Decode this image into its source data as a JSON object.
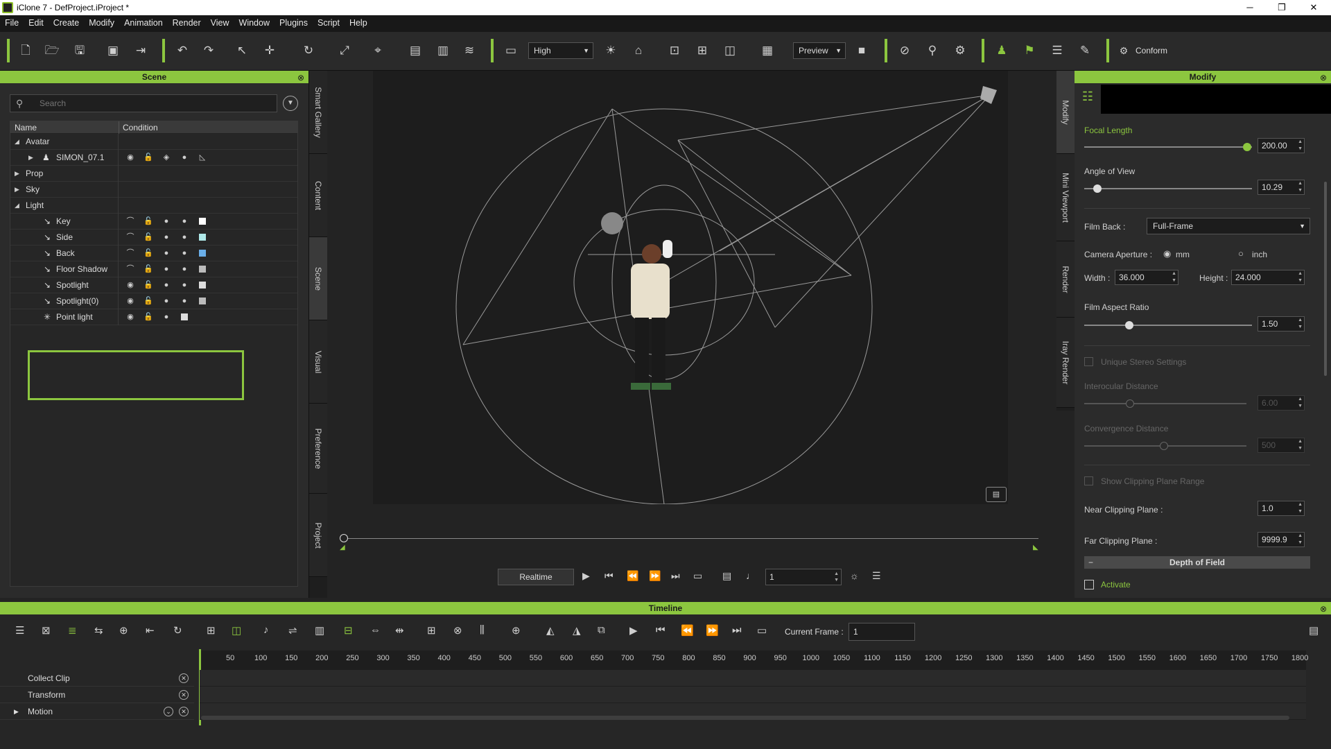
{
  "window": {
    "title": "iClone 7 - DefProject.iProject *",
    "controls": {
      "minimize": "─",
      "maximize": "❐",
      "close": "✕"
    }
  },
  "menu": [
    "File",
    "Edit",
    "Create",
    "Modify",
    "Animation",
    "Render",
    "View",
    "Window",
    "Plugins",
    "Script",
    "Help"
  ],
  "toolbar": {
    "quality": "High",
    "preview": "Preview",
    "conform": "Conform"
  },
  "scene_panel": {
    "title": "Scene",
    "search_placeholder": "Search",
    "columns": {
      "name": "Name",
      "condition": "Condition"
    },
    "rows": [
      {
        "label": "Avatar",
        "expanded": true
      },
      {
        "label": "SIMON_07.1"
      },
      {
        "label": "Prop"
      },
      {
        "label": "Sky"
      },
      {
        "label": "Light",
        "expanded": true
      },
      {
        "label": "Key",
        "swatch": "#ffffff"
      },
      {
        "label": "Side",
        "swatch": "#aee8e8"
      },
      {
        "label": "Back",
        "swatch": "#6aaee8"
      },
      {
        "label": "Floor Shadow",
        "swatch": "#bbbbbb"
      },
      {
        "label": "Spotlight",
        "swatch": "#dddddd"
      },
      {
        "label": "Spotlight(0)",
        "swatch": "#bbbbbb"
      },
      {
        "label": "Point light",
        "swatch": "#dddddd"
      }
    ]
  },
  "side_tabs": [
    "Smart Gallery",
    "Content",
    "Scene",
    "Visual",
    "Preference",
    "Project"
  ],
  "right_tabs": [
    "Modify",
    "Mini Viewport",
    "Render",
    "Iray Render"
  ],
  "playback": {
    "mode": "Realtime",
    "frame": "1"
  },
  "modify_panel": {
    "title": "Modify",
    "focal_length": {
      "label": "Focal Length",
      "value": "200.00",
      "fraction": 0.97
    },
    "angle_of_view": {
      "label": "Angle of View",
      "value": "10.29",
      "fraction": 0.08
    },
    "film_back": {
      "label": "Film Back :",
      "value": "Full-Frame"
    },
    "camera_aperture": {
      "label": "Camera Aperture :",
      "mm": "mm",
      "inch": "inch",
      "selected": "mm"
    },
    "width": {
      "label": "Width :",
      "value": "36.000"
    },
    "height": {
      "label": "Height :",
      "value": "24.000"
    },
    "film_aspect_ratio": {
      "label": "Film Aspect Ratio",
      "value": "1.50",
      "fraction": 0.27
    },
    "unique_stereo": "Unique Stereo Settings",
    "interocular": {
      "label": "Interocular Distance",
      "value": "6.00",
      "fraction": 0.28
    },
    "convergence": {
      "label": "Convergence Distance",
      "value": "500",
      "fraction": 0.49
    },
    "show_clipping": "Show Clipping Plane Range",
    "near_clip": {
      "label": "Near Clipping Plane :",
      "value": "1.0"
    },
    "far_clip": {
      "label": "Far Clipping Plane :",
      "value": "9999.9"
    },
    "dof": {
      "label": "Depth of Field",
      "collapse": "−"
    },
    "activate": "Activate"
  },
  "timeline": {
    "title": "Timeline",
    "current_frame_label": "Current Frame :",
    "current_frame": "1",
    "ticks": [
      "50",
      "100",
      "150",
      "200",
      "250",
      "300",
      "350",
      "400",
      "450",
      "500",
      "550",
      "600",
      "650",
      "700",
      "750",
      "800",
      "850",
      "900",
      "950",
      "1000",
      "1050",
      "1100",
      "1150",
      "1200",
      "1250",
      "1300",
      "1350",
      "1400",
      "1450",
      "1500",
      "1550",
      "1600",
      "1650",
      "1700",
      "1750",
      "1800"
    ],
    "tracks": [
      "Collect Clip",
      "Transform",
      "Motion"
    ]
  }
}
